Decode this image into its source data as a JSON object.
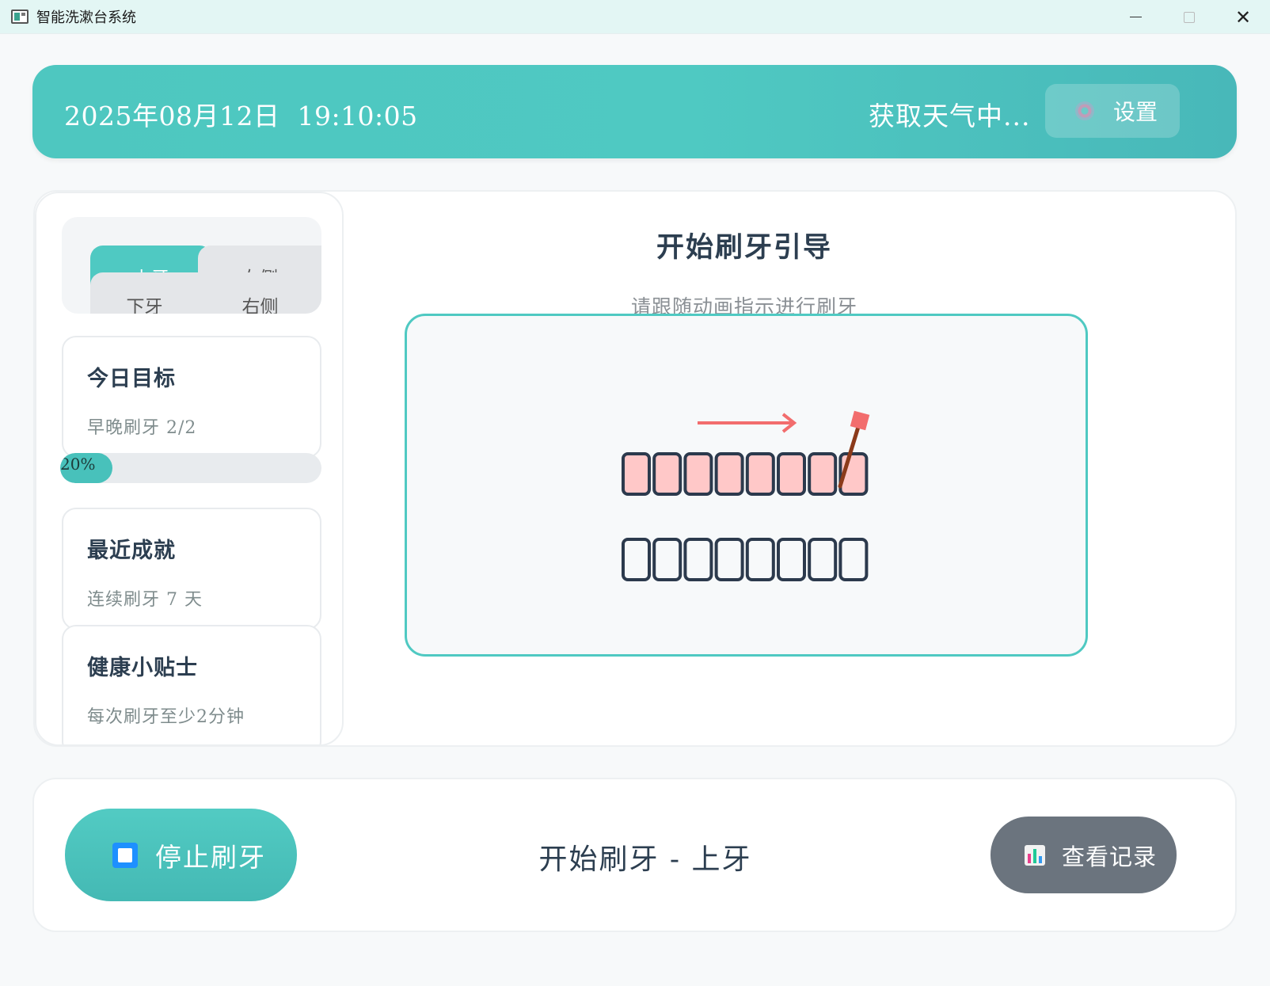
{
  "window": {
    "title": "智能洗漱台系统",
    "icon": "app-icon"
  },
  "header": {
    "date": "2025年08月12日",
    "time": "19:10:05",
    "weather": "获取天气中...",
    "settings_label": "设置",
    "settings_icon": "gear-icon"
  },
  "tabs": {
    "upper": "上牙",
    "right_back": "右侧",
    "lower": "下牙",
    "right": "右侧"
  },
  "cards": {
    "goal": {
      "title": "今日目标",
      "text": "早晚刷牙 2/2",
      "progress_label": "20%",
      "progress": 0.2
    },
    "achievement": {
      "title": "最近成就",
      "text": "连续刷牙 7 天"
    },
    "tips": {
      "title": "健康小贴士",
      "text": "每次刷牙至少2分钟"
    }
  },
  "guide": {
    "title": "开始刷牙引导",
    "subtitle": "请跟随动画指示进行刷牙",
    "highlighted_row": "upper",
    "arrow_direction": "right"
  },
  "bottom": {
    "stop_label": "停止刷牙",
    "stop_icon": "stop-icon",
    "status": "开始刷牙 - 上牙",
    "history_label": "查看记录",
    "history_icon": "bar-chart-icon"
  },
  "colors": {
    "accent": "#4fc9c2",
    "tooth_highlight": "#ffc8c8",
    "arrow": "#f26d6d",
    "history_button": "#6b747e"
  }
}
